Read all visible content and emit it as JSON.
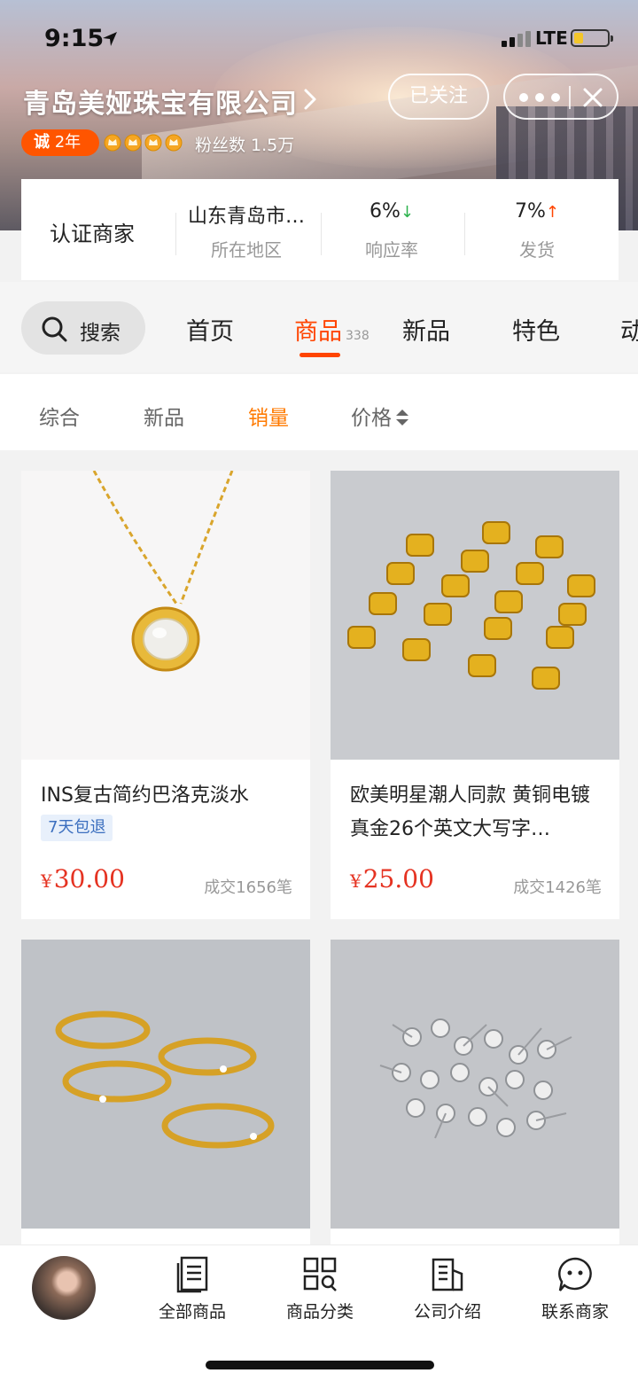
{
  "status_bar": {
    "time": "9:15",
    "network": "LTE"
  },
  "header": {
    "shop_name": "青岛美娅珠宝有限公司",
    "follow_label": "已关注",
    "cheng_label": "诚",
    "cheng_years": "2年",
    "fans_text": "粉丝数 1.5万"
  },
  "info": {
    "verified_label": "认证商家",
    "stats": [
      {
        "value": "山东青岛市…",
        "label": "所在地区"
      },
      {
        "value": "6%",
        "trend": "↓",
        "label": "响应率"
      },
      {
        "value": "7%",
        "trend": "↑",
        "label": "发货"
      }
    ]
  },
  "tabs": {
    "search_label": "搜索",
    "items": [
      {
        "label": "首页"
      },
      {
        "label": "商品",
        "count": "338",
        "active": true
      },
      {
        "label": "新品"
      },
      {
        "label": "特色"
      },
      {
        "label": "动"
      }
    ]
  },
  "sort": {
    "items": [
      {
        "label": "综合"
      },
      {
        "label": "新品"
      },
      {
        "label": "销量",
        "active": true
      },
      {
        "label": "价格"
      }
    ]
  },
  "products": [
    {
      "title": "INS复古简约巴洛克淡水",
      "tag": "7天包退",
      "currency": "¥",
      "price": "30.00",
      "sold": "成交1656笔",
      "image": "pearl-pendant-necklace"
    },
    {
      "title": "欧美明星潮人同款 黄铜电镀真金26个英文大写字…",
      "tag": "",
      "currency": "¥",
      "price": "25.00",
      "sold": "成交1426笔",
      "image": "gold-letter-rings"
    },
    {
      "image": "gold-hammered-rings"
    },
    {
      "image": "silver-stud-earrings"
    }
  ],
  "bottom_nav": {
    "items": [
      {
        "label": "全部商品",
        "icon": "list-icon"
      },
      {
        "label": "商品分类",
        "icon": "category-grid-icon"
      },
      {
        "label": "公司介绍",
        "icon": "building-icon"
      },
      {
        "label": "联系商家",
        "icon": "chat-icon"
      }
    ]
  },
  "colors": {
    "accent": "#ff4400",
    "price": "#e53322",
    "sort_active": "#ff7a00",
    "cheng_badge": "#ff5500"
  }
}
